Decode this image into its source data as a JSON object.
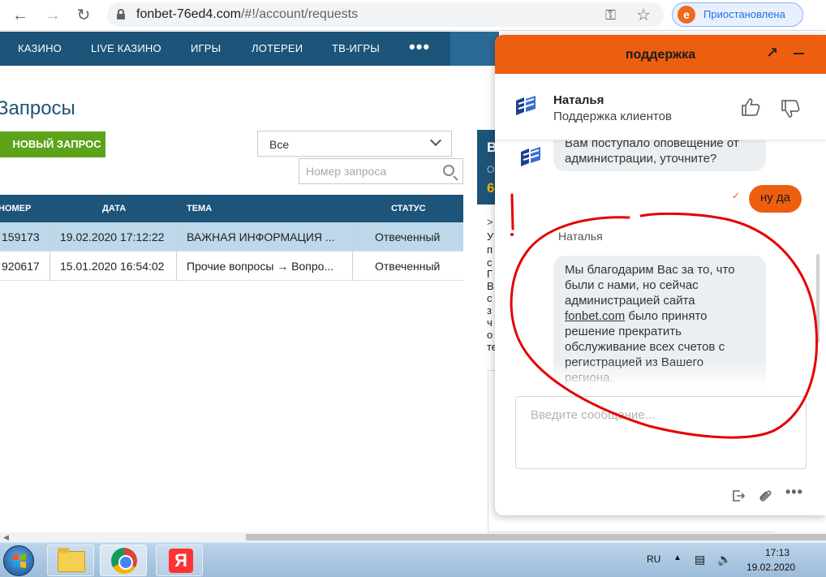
{
  "browser": {
    "url_host": "fonbet-76ed4.com",
    "url_path": "/#!/account/requests",
    "profile_initial": "e",
    "profile_status": "Приостановлена"
  },
  "site_nav": {
    "items": [
      "КАЗИНО",
      "LIVE КАЗИНО",
      "ИГРЫ",
      "ЛОТЕРЕИ",
      "ТВ-ИГРЫ"
    ],
    "more": "•••"
  },
  "requests": {
    "title": "Запросы",
    "new_button": "НОВЫЙ ЗАПРОС",
    "filter_value": "Все",
    "search_placeholder": "Номер запроса",
    "columns": [
      "НОМЕР",
      "ДАТА",
      "ТЕМА",
      "СТАТУС"
    ],
    "rows": [
      {
        "number": "159173",
        "date": "19.02.2020 17:12:22",
        "topic": "ВАЖНАЯ ИНФОРМАЦИЯ ...",
        "status": "Отвеченный"
      },
      {
        "number": "920617",
        "date": "15.01.2020 16:54:02",
        "topic": "Прочие вопросы → Вопро...",
        "status": "Отвеченный"
      }
    ]
  },
  "side_panel": {
    "head_letter": "В",
    "head_sub": "О",
    "head_num": "6",
    "text_letters": [
      ">",
      "У",
      "п",
      "с",
      "Г",
      "В",
      "с",
      "з",
      "ч",
      "о",
      "те"
    ]
  },
  "chat": {
    "title": "поддержка",
    "agent_name": "Наталья",
    "agent_role": "Поддержка клиентов",
    "message_1": "Вам поступало оповещение от администрации, уточните?",
    "reply": "ну да",
    "author": "Наталья",
    "message_2_part1": "Мы благодарим Вас за то, что были с нами, но сейчас администрацией сайта ",
    "message_2_link": "fonbet.com",
    "message_2_part2": " было принято решение прекратить обслуживание всех счетов с регистрацией из Вашего региона.",
    "input_placeholder": "Введите сообщение..."
  },
  "taskbar": {
    "lang": "RU",
    "time": "17:13",
    "date": "19.02.2020",
    "ya_letter": "Я"
  },
  "colors": {
    "nav_blue": "#1d5479",
    "chat_orange": "#ee5e10",
    "button_green": "#5ca31a",
    "selected_row": "#bcd8ea",
    "annotation_red": "#e50000"
  }
}
